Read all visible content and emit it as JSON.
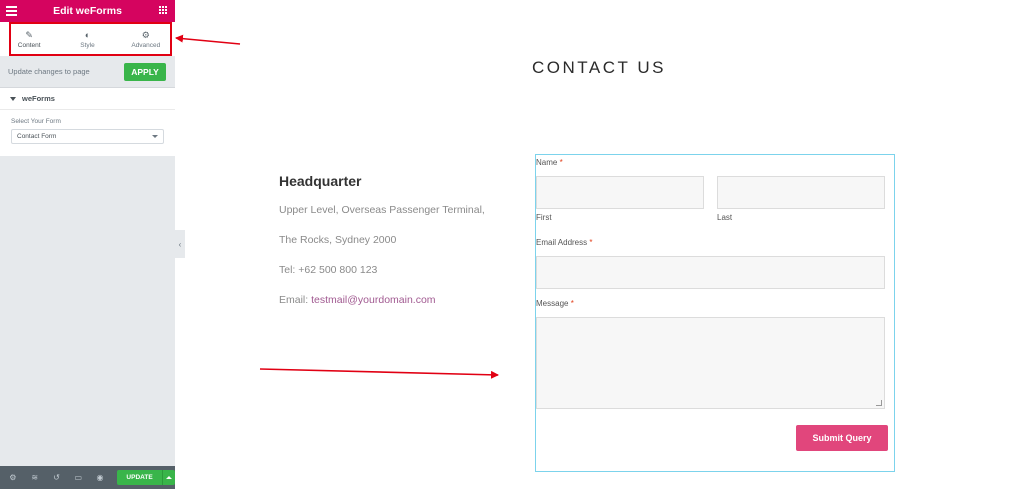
{
  "sidebar": {
    "title": "Edit weForms",
    "tabs": [
      {
        "label": "Content",
        "icon": "pencil-icon"
      },
      {
        "label": "Style",
        "icon": "contrast-icon"
      },
      {
        "label": "Advanced",
        "icon": "gear-icon"
      }
    ],
    "apply_text": "Update changes to page",
    "apply_label": "APPLY",
    "section_title": "weForms",
    "select_label": "Select Your Form",
    "select_value": "Contact Form",
    "update_label": "UPDATE"
  },
  "page": {
    "title": "CONTACT US"
  },
  "headquarter": {
    "title": "Headquarter",
    "line1": "Upper Level, Overseas Passenger Terminal,",
    "line2": "The Rocks, Sydney 2000",
    "line3": "Tel: +62 500 800 123",
    "email_label": "Email: ",
    "email": "testmail@yourdomain.com"
  },
  "form": {
    "name_label": "Name",
    "required_mark": "*",
    "first_label": "First",
    "last_label": "Last",
    "email_label": "Email Address",
    "message_label": "Message",
    "submit_label": "Submit Query"
  },
  "colors": {
    "brand": "#d5045f",
    "apply_green": "#39b54a",
    "submit_pink": "#e1467c",
    "annotation_red": "#e10013",
    "form_border": "#7cd3ec"
  }
}
